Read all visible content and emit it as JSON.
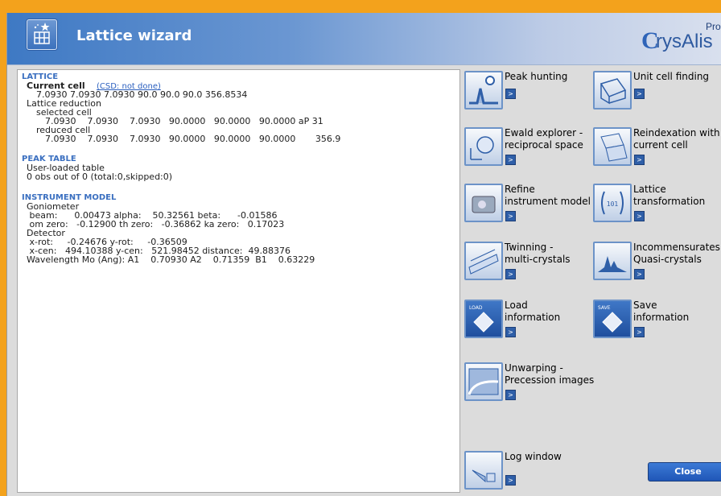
{
  "window": {
    "title": "Lattice wizard"
  },
  "brand": {
    "prefix": "C",
    "name": "rysAlis",
    "edition": "Pro"
  },
  "lattice": {
    "heading": "LATTICE",
    "current_cell_label": "Current cell",
    "csd_link": "(CSD: not done)",
    "current_cell_values": "7.0930 7.0930 7.0930 90.0 90.0 90.0 356.8534",
    "reduction_label": "Lattice reduction",
    "selected_label": "selected cell",
    "selected_values": "7.0930    7.0930    7.0930   90.0000   90.0000   90.0000 aP 31",
    "reduced_label": "reduced cell",
    "reduced_values": "7.0930    7.0930    7.0930   90.0000   90.0000   90.0000       356.9"
  },
  "peak_table": {
    "heading": "PEAK TABLE",
    "line1": "User-loaded table",
    "line2": "0 obs out of 0 (total:0,skipped:0)"
  },
  "instrument": {
    "heading": "INSTRUMENT MODEL",
    "goniometer_label": "Goniometer",
    "beam_line": " beam:      0.00473 alpha:    50.32561 beta:      -0.01586",
    "omzero_line": " om zero:   -0.12900 th zero:   -0.36862 ka zero:   0.17023",
    "detector_label": "Detector",
    "xrot_line": " x-rot:     -0.24676 y-rot:     -0.36509",
    "xcen_line": " x-cen:   494.10388 y-cen:   521.98452 distance:  49.88376",
    "wavelength_line": "Wavelength Mo (Ang): A1    0.70930 A2    0.71359  B1    0.63229"
  },
  "actions": [
    {
      "label1": "Peak hunting",
      "label2": ""
    },
    {
      "label1": "Unit cell finding",
      "label2": ""
    },
    {
      "label1": "Ewald explorer -",
      "label2": "reciprocal space"
    },
    {
      "label1": "Reindexation with",
      "label2": "current cell"
    },
    {
      "label1": "Refine",
      "label2": "instrument model"
    },
    {
      "label1": "Lattice",
      "label2": "transformation"
    },
    {
      "label1": "Twinning -",
      "label2": "multi-crystals"
    },
    {
      "label1": "Incommensurates",
      "label2": "Quasi-crystals"
    },
    {
      "label1": "Load",
      "label2": "information",
      "badge": "LOAD"
    },
    {
      "label1": "Save",
      "label2": "information",
      "badge": "SAVE"
    },
    {
      "label1": "Unwarping -",
      "label2": "Precession images"
    },
    {
      "label1": "Log window",
      "label2": ""
    }
  ],
  "arrow_glyph": ">",
  "close_label": "Close"
}
